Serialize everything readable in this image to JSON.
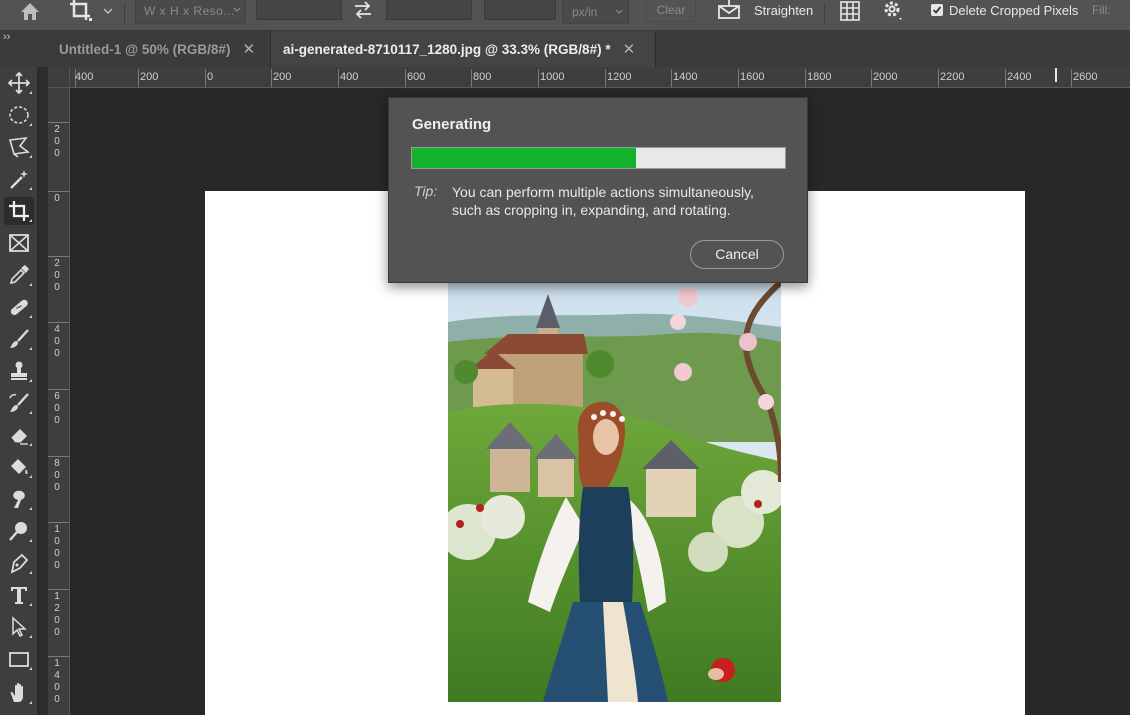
{
  "options_bar": {
    "home_icon": "home-icon",
    "crop_tool_icon": "crop-icon",
    "ratio_placeholder": "W x H x Reso...",
    "swap_icon": "swap-arrows-icon",
    "units": "px/in",
    "clear_label": "Clear",
    "straighten_label": "Straighten",
    "grid_icon": "grid-overlay-icon",
    "gear_icon": "gear-icon",
    "delete_cropped_label": "Delete Cropped Pixels",
    "delete_cropped_checked": true,
    "fill_label": "Fill:"
  },
  "tabs": [
    {
      "label": "Untitled-1 @ 50% (RGB/8#)",
      "active": false
    },
    {
      "label": "ai-generated-8710117_1280.jpg @ 33.3% (RGB/8#) *",
      "active": true
    }
  ],
  "tabs_expand": "››",
  "tools": [
    {
      "name": "move-tool",
      "icon": "move-icon"
    },
    {
      "name": "marquee-tool",
      "icon": "ellipse-marquee-icon"
    },
    {
      "name": "lasso-tool",
      "icon": "polygon-lasso-icon"
    },
    {
      "name": "magic-wand-tool",
      "icon": "magic-wand-icon"
    },
    {
      "name": "crop-tool",
      "icon": "crop-icon",
      "active": true
    },
    {
      "name": "frame-tool",
      "icon": "frame-icon"
    },
    {
      "name": "eyedropper-tool",
      "icon": "eyedropper-icon"
    },
    {
      "name": "healing-tool",
      "icon": "bandage-icon"
    },
    {
      "name": "brush-tool",
      "icon": "brush-icon"
    },
    {
      "name": "stamp-tool",
      "icon": "stamp-icon"
    },
    {
      "name": "history-brush-tool",
      "icon": "history-brush-icon"
    },
    {
      "name": "eraser-tool",
      "icon": "eraser-icon"
    },
    {
      "name": "paint-bucket-tool",
      "icon": "paint-bucket-icon"
    },
    {
      "name": "smudge-tool",
      "icon": "smudge-icon"
    },
    {
      "name": "dodge-tool",
      "icon": "dodge-icon"
    },
    {
      "name": "pen-tool",
      "icon": "pen-icon"
    },
    {
      "name": "type-tool",
      "icon": "type-icon"
    },
    {
      "name": "path-selection-tool",
      "icon": "arrow-cursor-icon"
    },
    {
      "name": "rectangle-tool",
      "icon": "rectangle-icon"
    },
    {
      "name": "hand-tool",
      "icon": "hand-icon"
    }
  ],
  "ruler_h_labels": [
    "400",
    "200",
    "0",
    "200",
    "400",
    "600",
    "800",
    "1000",
    "1200",
    "1400",
    "1600",
    "1800",
    "2000",
    "2200",
    "2400",
    "2600"
  ],
  "ruler_v_labels": [
    "200",
    "0",
    "200",
    "400",
    "600",
    "800",
    "1000",
    "1200",
    "1400"
  ],
  "dialog": {
    "title": "Generating",
    "progress": 0.6,
    "progress_color": "#12b22e",
    "tip_label": "Tip:",
    "tip_text": "You can perform multiple actions simultaneously, such as cropping in, expanding, and rotating.",
    "cancel_label": "Cancel"
  },
  "colors": {
    "options_bg": "#535353",
    "canvas_bg": "#282828",
    "accent": "#12b22e"
  }
}
